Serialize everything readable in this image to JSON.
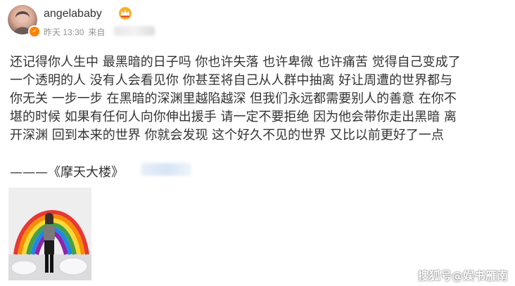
{
  "post": {
    "username": "angelababy",
    "time": "昨天 13:30",
    "source_prefix": "来自",
    "content": "还记得你人生中 最黑暗的日子吗 你也许失落 也许卑微 也许痛苦 觉得自己变成了\n一个透明的人 没有人会看见你 你甚至将自己从人群中抽离 好让周遭的世界都与\n你无关 一步一步 在黑暗的深渊里越陷越深 但我们永远都需要别人的善意 在你不\n堪的时候 如果有任何人向你伸出援手 请一定不要拒绝 因为他会带你走出黑暗 离\n开深渊 回到本来的世界 你就会发现 这个好久不见的世界 又比以前更好了一点",
    "signature": "———《摩天大楼》"
  },
  "watermark": "搜狐号@娱书雁南",
  "icons": {
    "verified_badge": "verified-badge-icon",
    "crown": "crown-icon"
  },
  "colors": {
    "text": "#333333",
    "meta": "#939393",
    "badge": "#ff8200"
  }
}
